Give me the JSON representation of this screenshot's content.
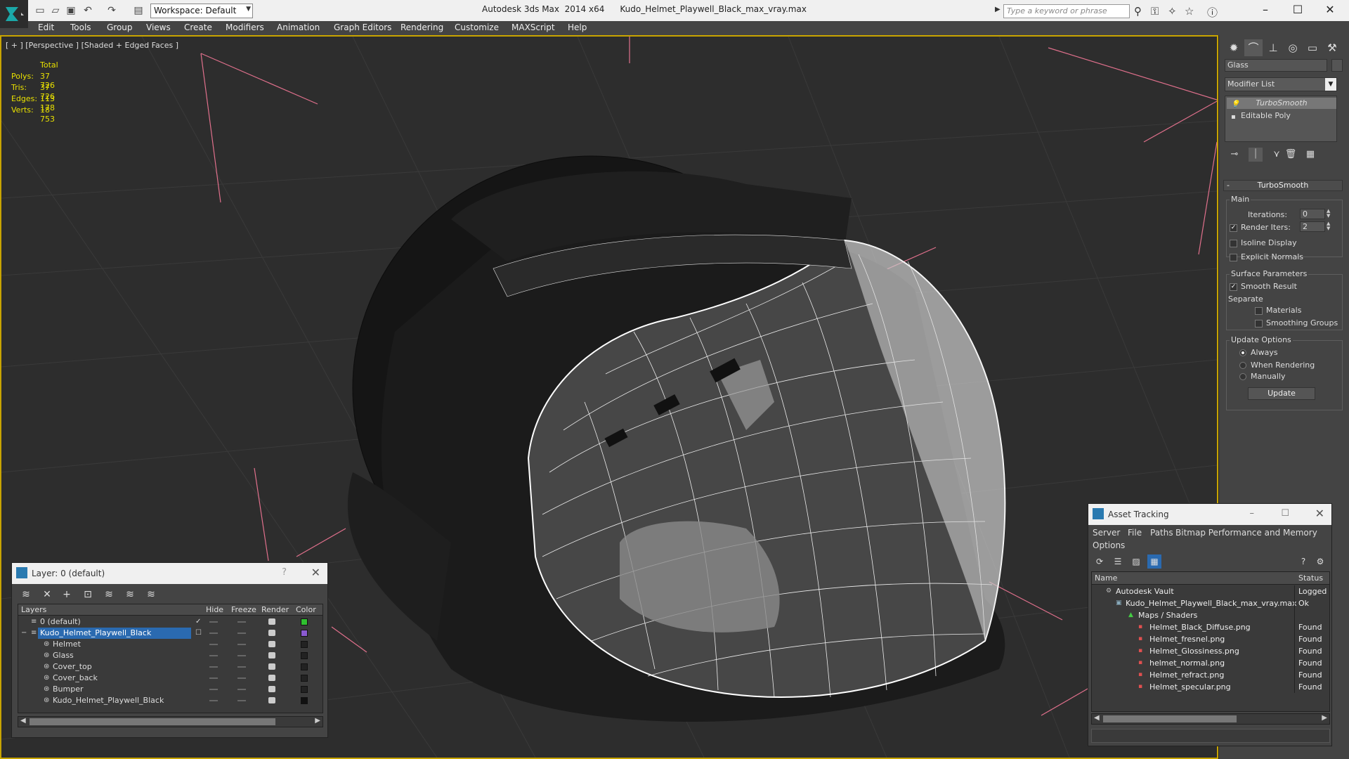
{
  "titlebar": {
    "workspace": "Workspace: Default",
    "app_name": "Autodesk 3ds Max  2014 x64",
    "file_name": "Kudo_Helmet_Playwell_Black_max_vray.max",
    "search_placeholder": "Type a keyword or phrase"
  },
  "menu": [
    "Edit",
    "Tools",
    "Group",
    "Views",
    "Create",
    "Modifiers",
    "Animation",
    "Graph Editors",
    "Rendering",
    "Customize",
    "MAXScript",
    "Help"
  ],
  "viewport": {
    "label": "[ + ] [Perspective ] [Shaded + Edged Faces ]",
    "stats_header": "Total",
    "stats": [
      {
        "key": "Polys:",
        "value": "37 726"
      },
      {
        "key": "Tris:",
        "value": "37 726"
      },
      {
        "key": "Edges:",
        "value": "113 178"
      },
      {
        "key": "Verts:",
        "value": "18 753"
      }
    ]
  },
  "command_panel": {
    "object_name": "Glass",
    "modifier_list": "Modifier List",
    "stack": [
      "TurboSmooth",
      "Editable Poly"
    ],
    "rollout_title": "TurboSmooth",
    "main_group": "Main",
    "iterations_label": "Iterations:",
    "iterations_value": "0",
    "render_iters_label": "Render Iters:",
    "render_iters_value": "2",
    "isoline_label": "Isoline Display",
    "explicit_normals_label": "Explicit Normals",
    "surface_group": "Surface Parameters",
    "smooth_result_label": "Smooth Result",
    "separate_label": "Separate",
    "materials_label": "Materials",
    "smoothing_groups_label": "Smoothing Groups",
    "update_group": "Update Options",
    "always_label": "Always",
    "when_rendering_label": "When Rendering",
    "manually_label": "Manually",
    "update_button": "Update"
  },
  "layer_dialog": {
    "title": "Layer: 0 (default)",
    "columns": [
      "Layers",
      "Hide",
      "Freeze",
      "Render",
      "Color"
    ],
    "rows": [
      {
        "name": "0 (default)",
        "color": "#2fc02f"
      },
      {
        "name": "Kudo_Helmet_Playwell_Black",
        "color": "#8a5ad0"
      },
      {
        "name": "Helmet",
        "color": "#222222"
      },
      {
        "name": "Glass",
        "color": "#222222"
      },
      {
        "name": "Cover_top",
        "color": "#222222"
      },
      {
        "name": "Cover_back",
        "color": "#222222"
      },
      {
        "name": "Bumper",
        "color": "#222222"
      },
      {
        "name": "Kudo_Helmet_Playwell_Black",
        "color": "#111111"
      }
    ]
  },
  "asset_dialog": {
    "title": "Asset Tracking",
    "menu": [
      "Server",
      "File",
      "Paths",
      "Bitmap Performance and Memory",
      "Options"
    ],
    "columns": [
      "Name",
      "Status"
    ],
    "rows": [
      {
        "name": "Autodesk Vault",
        "status": "Logged"
      },
      {
        "name": "Kudo_Helmet_Playwell_Black_max_vray.max",
        "status": "Ok"
      },
      {
        "name": "Maps / Shaders",
        "status": ""
      },
      {
        "name": "Helmet_Black_Diffuse.png",
        "status": "Found"
      },
      {
        "name": "Helmet_fresnel.png",
        "status": "Found"
      },
      {
        "name": "Helmet_Glossiness.png",
        "status": "Found"
      },
      {
        "name": "helmet_normal.png",
        "status": "Found"
      },
      {
        "name": "Helmet_refract.png",
        "status": "Found"
      },
      {
        "name": "Helmet_specular.png",
        "status": "Found"
      }
    ]
  }
}
